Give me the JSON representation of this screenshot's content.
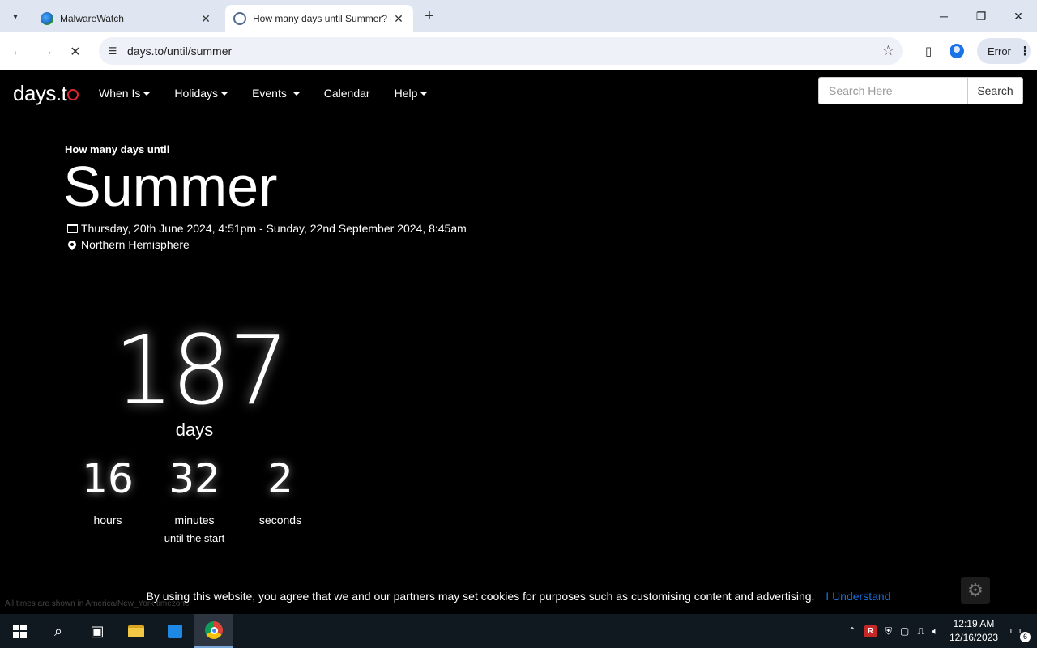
{
  "browser": {
    "tabs": [
      {
        "title": "MalwareWatch",
        "active": false
      },
      {
        "title": "How many days until Summer?",
        "active": true
      }
    ],
    "url": "days.to/until/summer",
    "error_label": "Error"
  },
  "site": {
    "logo": "days.t",
    "nav": [
      "When Is",
      "Holidays",
      "Events",
      "Calendar",
      "Help"
    ],
    "search_placeholder": "Search Here",
    "search_button": "Search"
  },
  "event": {
    "kicker": "How many days until",
    "title": "Summer",
    "date_range": "Thursday, 20th June 2024, 4:51pm - Sunday, 22nd September 2024, 8:45am",
    "location": "Northern Hemisphere"
  },
  "countdown": {
    "days": "187",
    "days_label": "days",
    "hours": "16",
    "hours_label": "hours",
    "minutes": "32",
    "minutes_label": "minutes",
    "seconds": "2",
    "seconds_label": "seconds",
    "suffix": "until the start"
  },
  "footer": {
    "timezone_note": "All times are shown in America/New_York timezone",
    "cookie_text": "By using this website, you agree that we and our partners may set cookies for purposes such as customising content and advertising.",
    "cookie_ok": "I Understand"
  },
  "taskbar": {
    "time": "12:19 AM",
    "date": "12/16/2023",
    "notifications": "6"
  },
  "colors": {
    "page_bg": "#000000",
    "accent_red": "#e0262d",
    "link_blue": "#1a6ed8",
    "tabstrip": "#dfe6f1"
  }
}
